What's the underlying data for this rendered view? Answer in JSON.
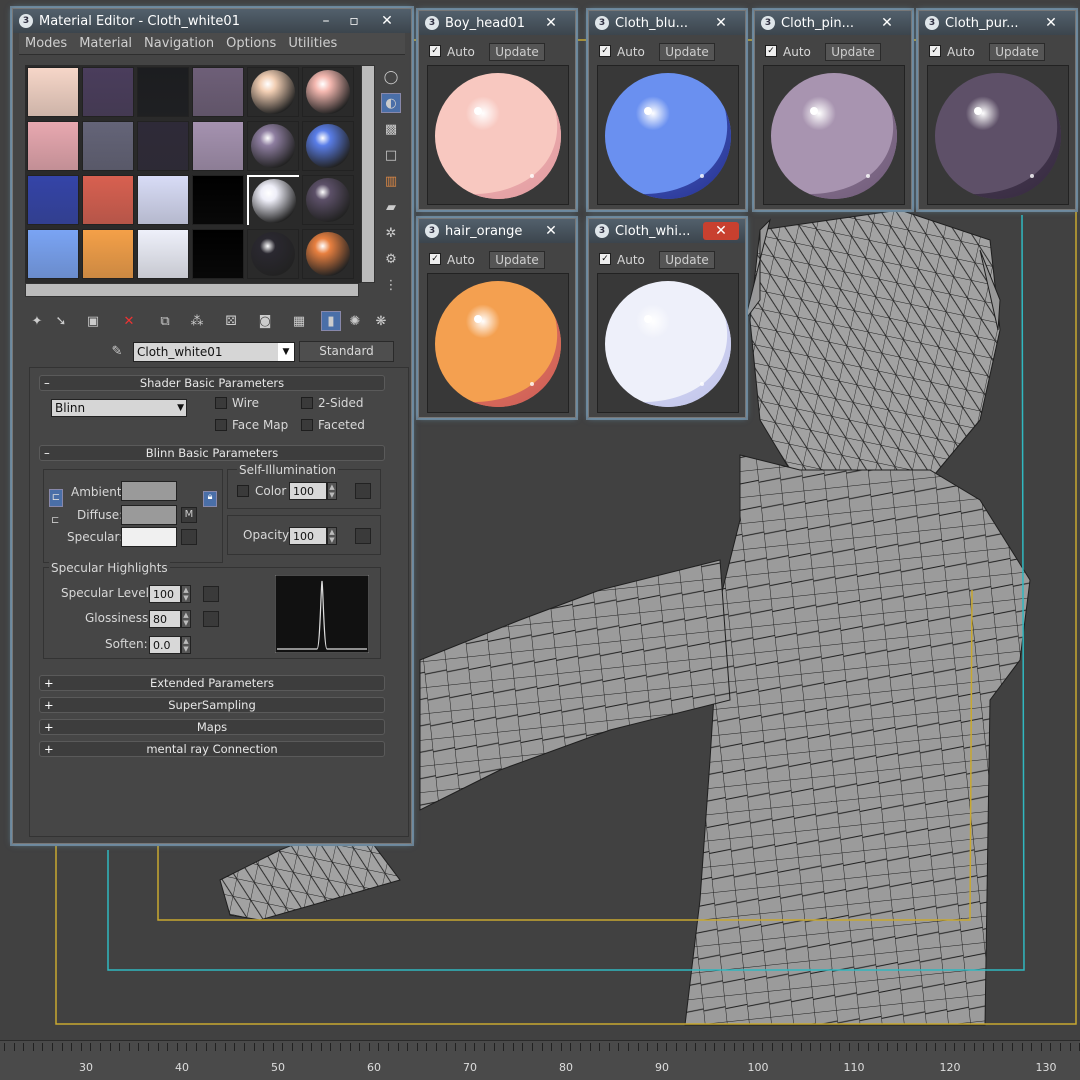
{
  "material_editor": {
    "title": "Material Editor - Cloth_white01",
    "menu": [
      "Modes",
      "Material",
      "Navigation",
      "Options",
      "Utilities"
    ],
    "material_name": "Cloth_white01",
    "material_type": "Standard",
    "shader_basic": {
      "header": "Shader Basic Parameters",
      "shader": "Blinn",
      "wire": "Wire",
      "two_sided": "2-Sided",
      "face_map": "Face Map",
      "faceted": "Faceted"
    },
    "blinn_basic": {
      "header": "Blinn Basic Parameters",
      "ambient": "Ambient:",
      "diffuse": "Diffuse:",
      "specular": "Specular:",
      "map_letter": "M",
      "self_illum": "Self-Illumination",
      "color": "Color",
      "color_value": "100",
      "opacity": "Opacity:",
      "opacity_value": "100"
    },
    "specular_highlights": {
      "header": "Specular Highlights",
      "level_label": "Specular Level:",
      "level": "100",
      "gloss_label": "Glossiness:",
      "gloss": "80",
      "soften_label": "Soften:",
      "soften": "0.0"
    },
    "rollouts": [
      "Extended Parameters",
      "SuperSampling",
      "Maps",
      "mental ray Connection"
    ],
    "slots": [
      "#f6d6c8",
      "#4a3d5c",
      "#1c1d20",
      "#6e5f78",
      "#f2cfb4",
      "#f4b8b0",
      "#e8a8b0",
      "#646478",
      "#2e2a38",
      "#a592b0",
      "#8e7ea0",
      "#5a7ee8",
      "#3444a8",
      "#d86050",
      "#d8dcf6",
      "#000000",
      "#eeeef8",
      "#5c5068",
      "#7aa4f4",
      "#f4a048",
      "#eef0fa",
      "#000000",
      "#2a2830",
      "#e88040"
    ],
    "slot_spheres": [
      4,
      5,
      10,
      11,
      16,
      17,
      22,
      23
    ]
  },
  "previews": [
    {
      "title": "Boy_head01",
      "auto": "Auto",
      "update": "Update",
      "color": "#f8c8c0",
      "band": "#e4a0a4"
    },
    {
      "title": "Cloth_blu...",
      "auto": "Auto",
      "update": "Update",
      "color": "#6a90f0",
      "band": "#2c3a9a"
    },
    {
      "title": "Cloth_pin...",
      "auto": "Auto",
      "update": "Update",
      "color": "#a894b0",
      "band": "#76607e"
    },
    {
      "title": "Cloth_pur...",
      "auto": "Auto",
      "update": "Update",
      "color": "#5e5068",
      "band": "#3a2e44"
    },
    {
      "title": "hair_orange",
      "auto": "Auto",
      "update": "Update",
      "color": "#f4a050",
      "band": "#d0605a"
    },
    {
      "title": "Cloth_whi...",
      "auto": "Auto",
      "update": "Update",
      "color": "#eef0fa",
      "band": "#c4c8ec"
    }
  ],
  "timeline": {
    "labels": [
      "30",
      "40",
      "50",
      "60",
      "70",
      "80",
      "90",
      "100",
      "110",
      "120",
      "130"
    ]
  },
  "colors": {
    "viewport": "#414141",
    "mesh": "#9a9a9a",
    "wire": "#222222",
    "frame_yellow": "#c8a830",
    "frame_cyan": "#30b8c0"
  }
}
